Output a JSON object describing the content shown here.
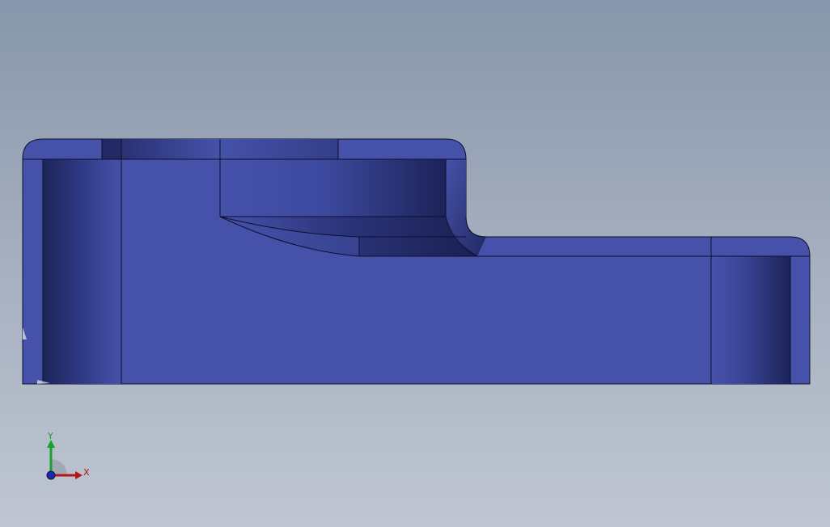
{
  "viewport": {
    "background_top": "#8796ab",
    "background_bottom": "#bfc6d2"
  },
  "model": {
    "face_color": "#4652aa",
    "shade_dark": "#1f2660",
    "edge_color": "#0d0f2a"
  },
  "triad": {
    "x_label": "X",
    "y_label": "Y",
    "x_color": "#b01818",
    "y_color": "#18a030",
    "z_color": "#1a2aa8"
  }
}
